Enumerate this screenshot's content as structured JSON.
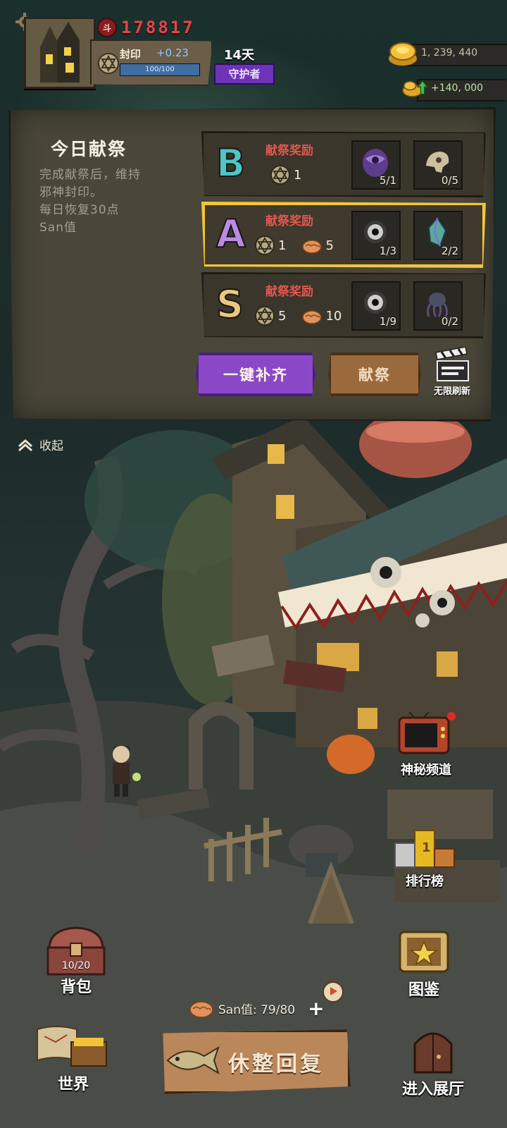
{
  "hud": {
    "power": "178817",
    "power_badge": "斗",
    "seal_label": "封印",
    "seal_rate": "+0.23",
    "seal_progress": "100/100",
    "seal_fraction": 1.0,
    "days": "14天",
    "title_badge": "守护者",
    "gold": "1, 239, 440",
    "gold_gain": "+140, 000"
  },
  "panel": {
    "title": "今日献祭",
    "desc": [
      "完成献祭后，维持",
      "邪神封印。",
      "每日恢复30点",
      "San值"
    ],
    "tiers": [
      {
        "grade": "B",
        "grade_color": "#4ec6c6",
        "reward_label": "献祭奖励",
        "seal": "1",
        "brain": "",
        "items": [
          {
            "icon": "purple-eye-orb-icon",
            "count": "5/1"
          },
          {
            "icon": "skull-bone-icon",
            "count": "0/5"
          }
        ],
        "selected": false
      },
      {
        "grade": "A",
        "grade_color": "#b98be6",
        "reward_label": "献祭奖励",
        "seal": "1",
        "brain": "5",
        "items": [
          {
            "icon": "eyeball-icon",
            "count": "1/3"
          },
          {
            "icon": "crystal-shard-icon",
            "count": "2/2"
          }
        ],
        "selected": true
      },
      {
        "grade": "S",
        "grade_color": "#e8c880",
        "reward_label": "献祭奖励",
        "seal": "5",
        "brain": "10",
        "items": [
          {
            "icon": "eyeball-icon",
            "count": "1/9"
          },
          {
            "icon": "tentacle-creature-icon",
            "count": "0/2"
          }
        ],
        "selected": false
      }
    ],
    "btn_fill": "一键补齐",
    "btn_offer": "献祭",
    "refresh_label": "无限刷新",
    "collapse_label": "收起"
  },
  "scene": {
    "tv_label": "神秘频道",
    "rank_label": "排行榜"
  },
  "bottom": {
    "bag_capacity": "10/20",
    "bag_label": "背包",
    "atlas_label": "图鉴",
    "world_label": "世界",
    "hall_label": "进入展厅",
    "san_text": "San值: 79/80",
    "rest_label": "休整回复"
  },
  "colors": {
    "accent_purple": "#8a48c9",
    "selected_border": "#f2c53d",
    "reward_red": "#e3574d",
    "power_red": "#e3454a"
  }
}
